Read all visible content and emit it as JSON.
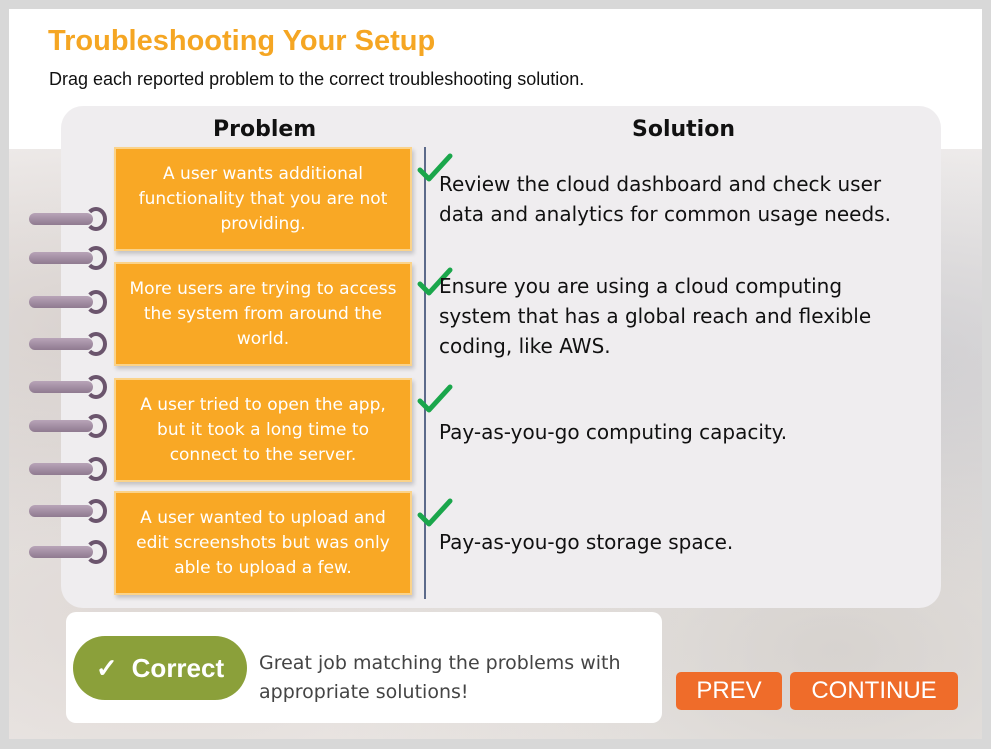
{
  "header": {
    "title": "Troubleshooting Your Setup",
    "instructions": "Drag each reported problem to the correct troubleshooting solution."
  },
  "columns": {
    "problem": "Problem",
    "solution": "Solution"
  },
  "pairs": [
    {
      "problem": "A user wants additional functionality that you are not providing.",
      "solution": "Review the cloud dashboard and check user data and analytics for common usage needs.",
      "status": "correct"
    },
    {
      "problem": "More users are trying to access the system from around the world.",
      "solution": "Ensure you are using a cloud computing system that has a global reach and flexible coding, like AWS.",
      "status": "correct"
    },
    {
      "problem": "A user tried to open the app, but it took a long time to connect to the server.",
      "solution": "Pay-as-you-go computing capacity.",
      "status": "correct"
    },
    {
      "problem": "A user wanted to upload and edit screenshots but was only able to upload a few.",
      "solution": "Pay-as-you-go storage space.",
      "status": "correct"
    }
  ],
  "feedback": {
    "badge": "Correct",
    "badge_icon": "✓",
    "message": "Great job matching the problems with appropriate solutions!"
  },
  "nav": {
    "prev_label": "PREV",
    "continue_label": "CONTINUE"
  },
  "colors": {
    "title": "#f5a623",
    "card": "#f9a825",
    "check": "#1aa64b",
    "correct_badge": "#8ba03a",
    "button": "#ef6c2a"
  },
  "icons": {
    "check": "checkmark-icon",
    "ring": "notebook-ring-icon"
  }
}
